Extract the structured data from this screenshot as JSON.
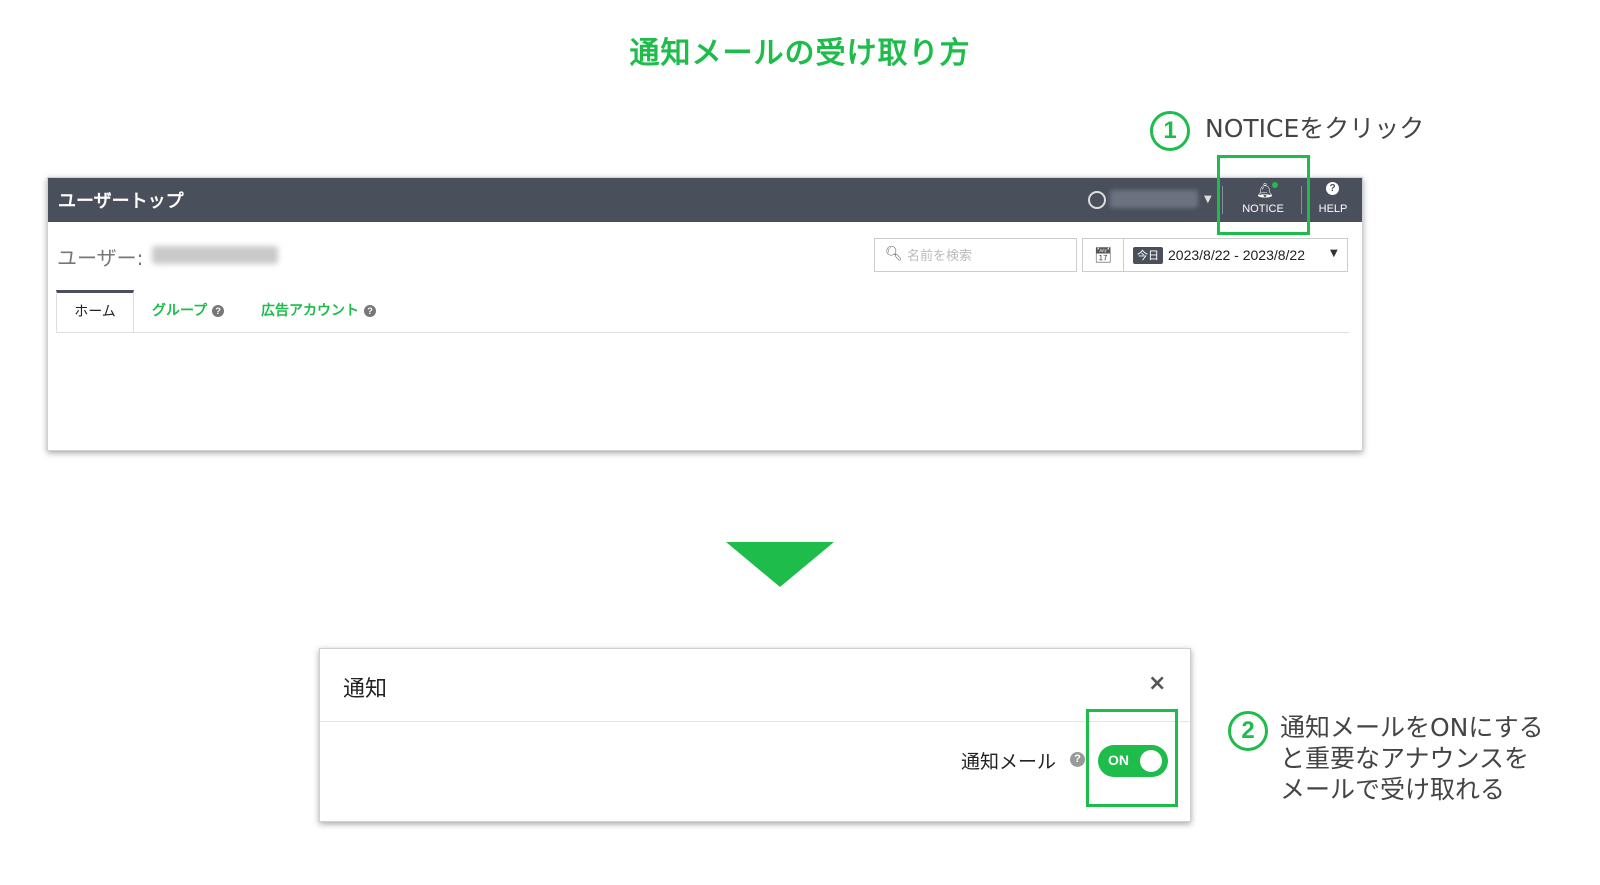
{
  "title": "通知メールの受け取り方",
  "step1": {
    "number": "1",
    "text": "NOTICEをクリック"
  },
  "step2": {
    "number": "2",
    "lines": [
      "通知メールをONにする",
      "と重要なアナウンスを",
      "メールで受け取れる"
    ]
  },
  "topbar": {
    "title": "ユーザートップ",
    "notice_label": "NOTICE",
    "help_label": "HELP"
  },
  "user": {
    "label": "ユーザー:"
  },
  "search": {
    "placeholder": "名前を検索"
  },
  "date": {
    "today_badge": "今日",
    "range": "2023/8/22 - 2023/8/22"
  },
  "tabs": [
    {
      "label": "ホーム"
    },
    {
      "label": "グループ"
    },
    {
      "label": "広告アカウント"
    }
  ],
  "modal": {
    "title": "通知",
    "close": "×",
    "mail_label": "通知メール",
    "toggle_label": "ON",
    "help": "?"
  },
  "icons": {
    "help": "?"
  },
  "colors": {
    "accent": "#1ebc4a",
    "topbar": "#4a4f5c"
  }
}
